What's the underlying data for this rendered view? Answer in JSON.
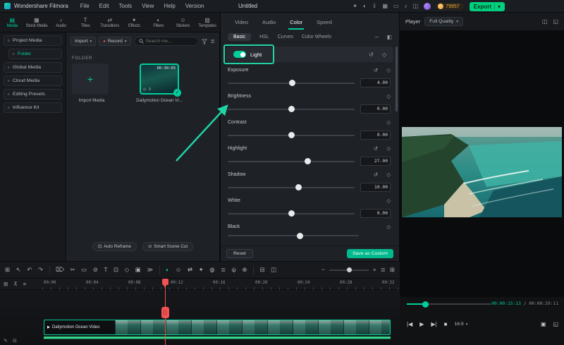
{
  "colors": {
    "accent": "#00ce9b",
    "export_green": "#00d07e",
    "coin_orange": "#f0a93c",
    "playhead_red": "#f25252",
    "save_green": "#00b98c"
  },
  "icons": {
    "reset": "↺",
    "keyframe": "◇",
    "caret_down": "▾",
    "check": "✓",
    "plus": "+",
    "record_dot": "●",
    "sidebar_arrow": "▹",
    "menu_dash": "─",
    "dock": "◧",
    "list": "≣",
    "clip_download": "⇩",
    "clip_quality": "◇",
    "clip_play": "▶"
  },
  "menubar": {
    "app_name": "Wondershare Filmora",
    "menus": [
      "File",
      "Edit",
      "Tools",
      "View",
      "Help",
      "Version"
    ],
    "title": "Untitled",
    "icons": [
      {
        "name": "ai-icon",
        "glyph": "✦"
      },
      {
        "name": "theme-icon",
        "glyph": "◐"
      },
      {
        "name": "download-icon",
        "glyph": "⇩"
      },
      {
        "name": "workspace-icon",
        "glyph": "▦"
      },
      {
        "name": "mobile-icon",
        "glyph": "▭"
      },
      {
        "name": "audio-icon",
        "glyph": "♪"
      },
      {
        "name": "layout-icon",
        "glyph": "◫"
      }
    ],
    "coins": "79957",
    "export_label": "Export"
  },
  "tabs": [
    {
      "label": "Media",
      "glyph": "▤"
    },
    {
      "label": "Stock Media",
      "glyph": "▦"
    },
    {
      "label": "Audio",
      "glyph": "♪"
    },
    {
      "label": "Titles",
      "glyph": "T"
    },
    {
      "label": "Transitions",
      "glyph": "⇄"
    },
    {
      "label": "Effects",
      "glyph": "✦"
    },
    {
      "label": "Filters",
      "glyph": "◐"
    },
    {
      "label": "Stickers",
      "glyph": "☺"
    },
    {
      "label": "Templates",
      "glyph": "▧"
    }
  ],
  "sidebar": {
    "items": [
      "Project Media",
      "Folder",
      "Global Media",
      "Cloud Media",
      "Editing Presets",
      "Influence Kit"
    ]
  },
  "media": {
    "import_label": "Import",
    "record_label": "Record",
    "search_placeholder": "Search me...",
    "folder_label": "FOLDER",
    "import_tile_label": "Import Media",
    "clip_name": "Dailymotion Ocean Vi...",
    "clip_duration": "00:30:03",
    "footer_buttons": [
      {
        "label": "Auto Reframe",
        "glyph": "⊡"
      },
      {
        "label": "Smart Scene Cut",
        "glyph": "⊙"
      }
    ]
  },
  "color_panel": {
    "tabs": [
      "Video",
      "Audio",
      "Color",
      "Speed"
    ],
    "active_tab": "Color",
    "subtabs": [
      "Basic",
      "HSL",
      "Curves",
      "Color Wheels"
    ],
    "active_subtab": "Basic",
    "light_label": "Light",
    "sliders": [
      {
        "name": "Exposure",
        "value": "4.00",
        "pos": 51
      },
      {
        "name": "Brightness",
        "value": "0.00",
        "pos": 50
      },
      {
        "name": "Contrast",
        "value": "0.00",
        "pos": 50
      },
      {
        "name": "Highlight",
        "value": "27.00",
        "pos": 63
      },
      {
        "name": "Shadow",
        "value": "10.00",
        "pos": 56
      },
      {
        "name": "White",
        "value": "0.00",
        "pos": 50
      },
      {
        "name": "Black",
        "value": "",
        "pos": 55
      }
    ],
    "reset_label": "Reset",
    "save_label": "Save as Custom"
  },
  "player": {
    "label": "Player",
    "quality": "Full Quality",
    "header_icons": [
      {
        "name": "split-view-icon",
        "glyph": "◫"
      },
      {
        "name": "detach-icon",
        "glyph": "◱"
      }
    ],
    "time_current": "00:00:15:13",
    "time_total": " / 00:00:29:11",
    "transport": [
      {
        "name": "prev-frame-icon",
        "glyph": "|◀"
      },
      {
        "name": "play-icon",
        "glyph": "▶"
      },
      {
        "name": "next-frame-icon",
        "glyph": "▶|"
      },
      {
        "name": "stop-icon",
        "glyph": "■"
      }
    ],
    "ratio": "16:9",
    "right_icons": [
      {
        "name": "snapshot-icon",
        "glyph": "▣"
      },
      {
        "name": "fullscreen-icon",
        "glyph": "◱"
      }
    ]
  },
  "toolbar": {
    "icons": [
      {
        "name": "add-media-icon",
        "glyph": "⊞"
      },
      {
        "name": "pointer-icon",
        "glyph": "↖"
      },
      {
        "name": "undo-icon",
        "glyph": "↶"
      },
      {
        "name": "redo-icon",
        "glyph": "↷"
      },
      {
        "name": "delete-icon",
        "glyph": "⌦"
      },
      {
        "name": "split-icon",
        "glyph": "✂"
      },
      {
        "name": "crop-icon",
        "glyph": "▭"
      },
      {
        "name": "speed-icon",
        "glyph": "⊘"
      },
      {
        "name": "text-icon",
        "glyph": "T"
      },
      {
        "name": "pip-icon",
        "glyph": "⊡"
      },
      {
        "name": "keyframe-icon",
        "glyph": "◇"
      },
      {
        "name": "snapshot-icon",
        "glyph": "▣"
      },
      {
        "name": "more-tools-icon",
        "glyph": "≫"
      },
      {
        "name": "color-correction-icon",
        "glyph": "◐"
      },
      {
        "name": "sticker-icon",
        "glyph": "☺"
      },
      {
        "name": "transition-icon",
        "glyph": "⇄"
      },
      {
        "name": "effect-icon",
        "glyph": "✦"
      },
      {
        "name": "mask-icon",
        "glyph": "◍"
      },
      {
        "name": "audio-mixer-icon",
        "glyph": "≣"
      },
      {
        "name": "voiceover-icon",
        "glyph": "ψ"
      },
      {
        "name": "marker-icon",
        "glyph": "⊕"
      },
      {
        "name": "split-screen-icon",
        "glyph": "⊟"
      },
      {
        "name": "layout-icon",
        "glyph": "◫"
      }
    ],
    "zoom_out": "−",
    "zoom_in": "+",
    "right_icons": [
      {
        "name": "track-height-icon",
        "glyph": "≣"
      },
      {
        "name": "fit-icon",
        "glyph": "⊞"
      }
    ]
  },
  "timeline": {
    "header_icons": [
      {
        "name": "manage-tracks-icon",
        "glyph": "⊞"
      },
      {
        "name": "snap-icon",
        "glyph": "⊼"
      },
      {
        "name": "ripple-icon",
        "glyph": "≡"
      }
    ],
    "ruler": [
      "00:00",
      "00:04",
      "00:08",
      "00:12",
      "00:16",
      "00:20",
      "00:24",
      "00:28",
      "00:32"
    ],
    "clip_label": "Dailymotion Ocean Video",
    "bottom_icons": [
      {
        "name": "edit-tools-icon",
        "glyph": "✎"
      },
      {
        "name": "collapse-icon",
        "glyph": "⊟"
      }
    ]
  }
}
